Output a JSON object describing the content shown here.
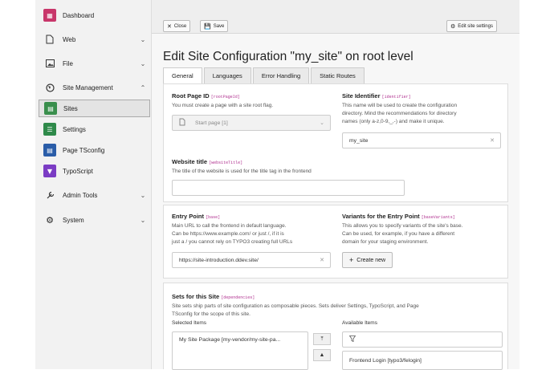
{
  "sidebar": {
    "items": [
      {
        "label": "Dashboard",
        "icon": "dashboard-icon"
      },
      {
        "label": "Web",
        "icon": "page-icon"
      },
      {
        "label": "File",
        "icon": "image-file-icon"
      },
      {
        "label": "Site Management",
        "icon": "globe-icon"
      },
      {
        "label": "Sites",
        "icon": "sites-icon"
      },
      {
        "label": "Settings",
        "icon": "settings-module-icon"
      },
      {
        "label": "Page TSconfig",
        "icon": "tsconfig-icon"
      },
      {
        "label": "TypoScript",
        "icon": "typoscript-icon"
      },
      {
        "label": "Admin Tools",
        "icon": "admin-tools-icon"
      },
      {
        "label": "System",
        "icon": "system-gear-icon"
      }
    ]
  },
  "toolbar": {
    "close_label": "Close",
    "save_label": "Save",
    "edit_site_settings_label": "Edit site settings"
  },
  "page_title": "Edit Site Configuration \"my_site\" on root level",
  "tabs": [
    "General",
    "Languages",
    "Error Handling",
    "Static Routes"
  ],
  "root_page": {
    "title": "Root Page ID",
    "code": "[rootPageId]",
    "desc": "You must create a page with a site root flag.",
    "select_value": "Start page [1]"
  },
  "site_identifier": {
    "title": "Site Identifier",
    "code": "[identifier]",
    "desc_1": "This name will be used to create the configuration",
    "desc_2": "directory. Mind the recommendations for directory",
    "desc_3": "names (only a-z,0-9,_,-) and make it unique.",
    "value": "my_site"
  },
  "website_title": {
    "title": "Website title",
    "code": "[websiteTitle]",
    "desc": "The title of the website is used for the title tag in the frontend",
    "value": ""
  },
  "entry_point": {
    "title": "Entry Point",
    "code": "[base]",
    "desc_1": "Main URL to call the frontend in default language.",
    "desc_2": "Can be https://www.example.com/ or just /, if it is",
    "desc_3": "just a / you cannot rely on TYPO3 creating full URLs",
    "value": "https://site-introduction.ddev.site/"
  },
  "variants": {
    "title": "Variants for the Entry Point",
    "code": "[baseVariants]",
    "desc_1": "This allows you to specify variants of the site's base.",
    "desc_2": "Can be used, for example, if you have a different",
    "desc_3": "domain for your staging environment.",
    "create_label": "Create new"
  },
  "sets": {
    "title": "Sets for this Site",
    "code": "[dependencies]",
    "desc_1": "Site sets ship parts of site configuration as composable pieces. Sets deliver Settings, TypoScript, and Page",
    "desc_2": "TSconfig for the scope of this site.",
    "selected_label": "Selected Items",
    "available_label": "Available Items",
    "selected_items": [
      "My Site Package [my-vendor/my-site-pa..."
    ],
    "available_items": [
      "Frontend Login [typo3/felogin]"
    ]
  },
  "colors": {
    "dashboard": "#c8366a",
    "sites": "#3a8f4d",
    "settings": "#2f8a4a",
    "tsconfig": "#2a5da8",
    "typoscript": "#7b3cc4",
    "accent_code": "#b0308f"
  }
}
